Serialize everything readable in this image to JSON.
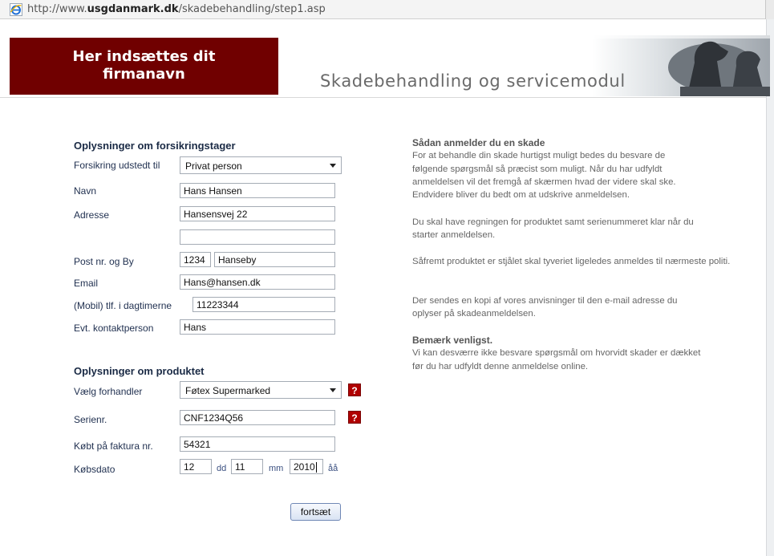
{
  "browser": {
    "url_prefix": "http://www.",
    "url_domain": "usgdanmark.dk",
    "url_path": "/skadebehandling/step1.asp"
  },
  "header": {
    "logo_line1": "Her indsættes dit",
    "logo_line2": "firmanavn",
    "title": "Skadebehandling og servicemodul",
    "brand_color": "#700000"
  },
  "form": {
    "section1_title": "Oplysninger om forsikringstager",
    "insured_label": "Forsikring udstedt til",
    "insured_value": "Privat person",
    "name_label": "Navn",
    "name_value": "Hans Hansen",
    "address_label": "Adresse",
    "address1_value": "Hansensvej 22",
    "address2_value": "",
    "postal_label": "Post nr. og By",
    "postal_value": "1234",
    "city_value": "Hanseby",
    "email_label": "Email",
    "email_value": "Hans@hansen.dk",
    "phone_label": "(Mobil) tlf. i dagtimerne",
    "phone_value": "11223344",
    "contact_label": "Evt. kontaktperson",
    "contact_value": "Hans",
    "section2_title": "Oplysninger om produktet",
    "dealer_label": "Vælg forhandler",
    "dealer_value": "Føtex Supermarked",
    "serial_label": "Serienr.",
    "serial_value": "CNF1234Q56",
    "invoice_label": "Købt på faktura nr.",
    "invoice_value": "54321",
    "date_label": "Købsdato",
    "day_value": "12",
    "day_unit": "dd",
    "month_value": "11",
    "month_unit": "mm",
    "year_value": "2010",
    "year_unit": "åå",
    "help_symbol": "?",
    "submit_label": "fortsæt"
  },
  "info": {
    "heading1": "Sådan anmelder du en skade",
    "p1": "For at behandle din skade hurtigst muligt bedes du besvare de følgende spørgsmål så præcist som muligt. Når du har udfyldt anmeldelsen vil det fremgå af skærmen hvad der videre skal ske. Endvidere bliver du bedt om at udskrive anmeldelsen.",
    "p2": "Du skal have regningen for produktet samt serienummeret klar når du starter anmeldelsen.",
    "p3": "Såfremt produktet er stjålet skal tyveriet ligeledes anmeldes til nærmeste politi.",
    "p4": "Der sendes en kopi af vores anvisninger til den e-mail adresse du oplyser på skadeanmeldelsen.",
    "heading2": "Bemærk venligst.",
    "p5": "Vi kan desværre ikke besvare spørgsmål om hvorvidt skader er dækket før du har udfyldt denne anmeldelse online."
  }
}
